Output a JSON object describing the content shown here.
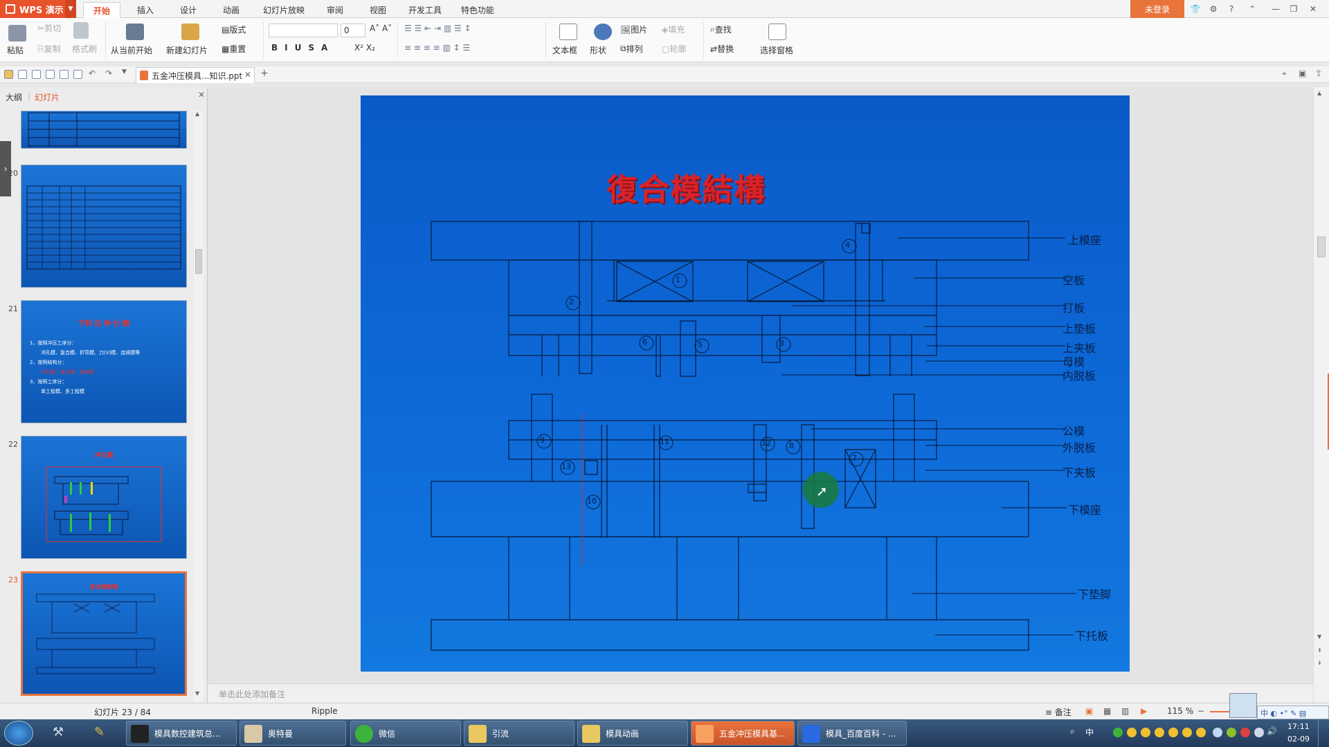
{
  "app": {
    "name": "WPS 演示",
    "login": "未登录"
  },
  "tabs": [
    "开始",
    "插入",
    "设计",
    "动画",
    "幻灯片放映",
    "审阅",
    "视图",
    "开发工具",
    "特色功能"
  ],
  "ribbon": {
    "paste": "粘贴",
    "cut": "剪切",
    "copy": "复制",
    "format_painter": "格式刷",
    "from_current": "从当前开始",
    "new_slide": "新建幻灯片",
    "layout": "版式",
    "reset": "重置",
    "font_size": "0",
    "textbox": "文本框",
    "shape": "形状",
    "picture": "图片",
    "arrange": "排列",
    "fill": "填充",
    "outline": "轮廓",
    "find": "查找",
    "replace": "替换",
    "select_pane": "选择窗格"
  },
  "doc_tab": "五金冲压模具...知识.ppt",
  "left_panel": {
    "outline_tab": "大纲",
    "slides_tab": "幻灯片"
  },
  "thumbnails": [
    {
      "num": "20"
    },
    {
      "num": "21",
      "title": "下料 拉 伸 分 類",
      "lines": [
        "1、按照冲压工序分：",
        "冲孔模、复合模、折弯模、刀(V)模、连续模等",
        "2、按照结构分：",
        "冲孔模、复合模、连续模",
        "3、按照工序分：",
        "单工程模、多工程模"
      ]
    },
    {
      "num": "22",
      "title": "冲孔模"
    },
    {
      "num": "23",
      "title": "复合模結構"
    }
  ],
  "slide": {
    "title": "復合模結構",
    "labels": [
      "上模座",
      "空板",
      "打板",
      "上垫板",
      "上夹板",
      "母模",
      "内脱板",
      "公模",
      "外脱板",
      "下夹板",
      "下模座",
      "下垫脚",
      "下托板"
    ],
    "numbers": [
      "1",
      "2",
      "3",
      "4",
      "5",
      "6",
      "7",
      "8",
      "9",
      "10",
      "11",
      "12",
      "13"
    ]
  },
  "notes_placeholder": "单击此处添加备注",
  "status": {
    "slide_count": "幻灯片 23 / 84",
    "theme": "Ripple",
    "notes": "备注",
    "zoom": "115 %"
  },
  "taskbar": {
    "items": [
      "模具数控建筑总...",
      "奥特曼",
      "微信",
      "引流",
      "模具动画",
      "五金冲压模具基...",
      "模具_百度百科 - ..."
    ],
    "time": "17:11",
    "date": "02-09",
    "ime": "中"
  },
  "colors": {
    "accent": "#e8532b",
    "slide_bg": "#0d62cf",
    "slide_title": "#d8232a"
  }
}
